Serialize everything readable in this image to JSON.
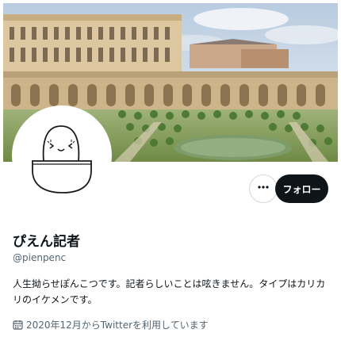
{
  "profile": {
    "display_name": "ぴえん記者",
    "handle": "@pienpenc",
    "bio": "人生拗らせぽんこつです。記者らしいことは呟きません。タイプはカリカリのイケメンです。",
    "joined": "2020年12月からTwitterを利用しています"
  },
  "actions": {
    "follow_label": "フォロー",
    "more_icon": "ellipsis-icon"
  },
  "icons": {
    "joined": "calendar-icon"
  },
  "colors": {
    "text_primary": "#0f1419",
    "text_secondary": "#536471",
    "follow_bg": "#0f1419",
    "follow_text": "#ffffff",
    "border": "#cfd9de"
  }
}
